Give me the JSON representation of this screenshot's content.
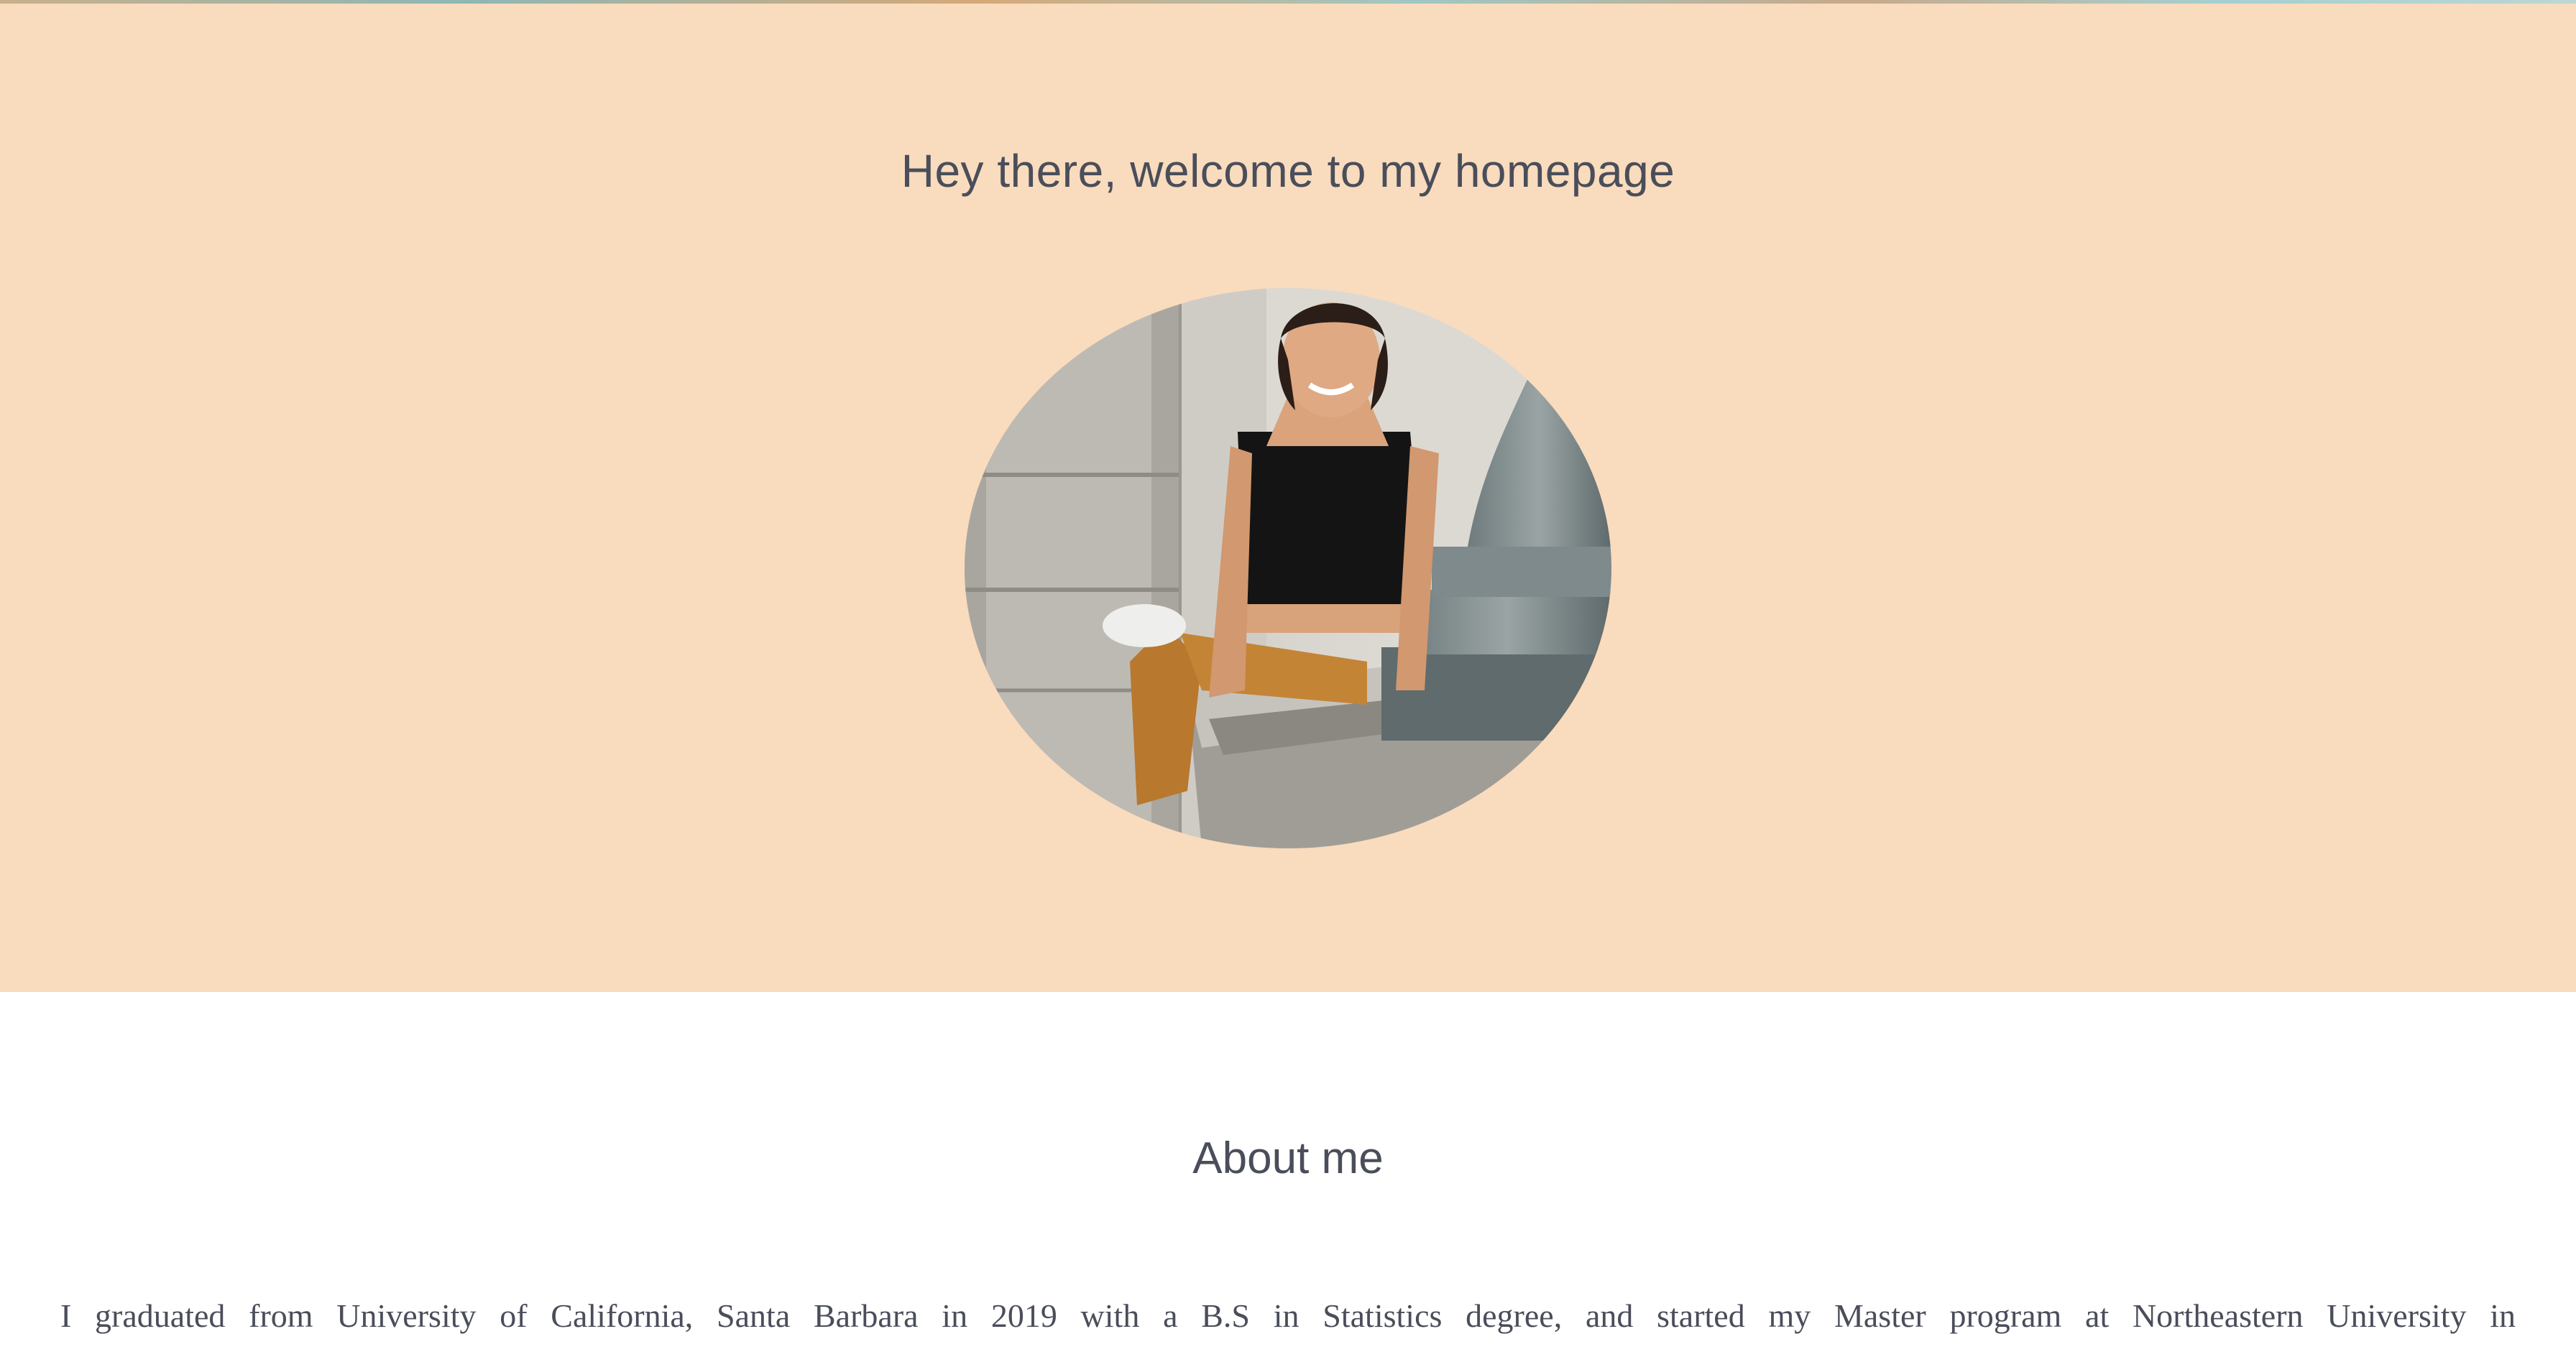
{
  "hero": {
    "title": "Hey there, welcome to my homepage",
    "background_color": "#f9dbbd"
  },
  "portrait": {
    "icon": "profile-photo"
  },
  "about": {
    "title": "About me",
    "text": "I graduated from University of California, Santa Barbara in 2019 with a B.S in Statistics degree, and started my Master program at Northeastern University in"
  },
  "colors": {
    "text": "#4a4e5a",
    "page_background": "#ffffff"
  }
}
